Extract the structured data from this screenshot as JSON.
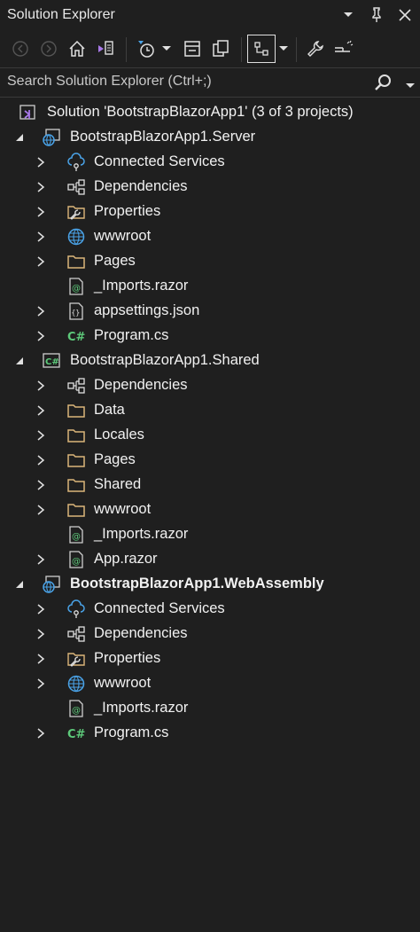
{
  "window": {
    "title": "Solution Explorer"
  },
  "search": {
    "placeholder": "Search Solution Explorer (Ctrl+;)"
  },
  "colors": {
    "background": "#1f1f1f",
    "text": "#f1f1f1",
    "accent_blue": "#4aa3e8",
    "folder": "#dcb67a",
    "csharp": "#5dc97a"
  },
  "tree": {
    "solution": "Solution 'BootstrapBlazorApp1' (3 of 3 projects)",
    "server": {
      "name": "BootstrapBlazorApp1.Server",
      "items": [
        "Connected Services",
        "Dependencies",
        "Properties",
        "wwwroot",
        "Pages",
        "_Imports.razor",
        "appsettings.json",
        "Program.cs"
      ]
    },
    "shared": {
      "name": "BootstrapBlazorApp1.Shared",
      "items": [
        "Dependencies",
        "Data",
        "Locales",
        "Pages",
        "Shared",
        "wwwroot",
        "_Imports.razor",
        "App.razor"
      ]
    },
    "wasm": {
      "name": "BootstrapBlazorApp1.WebAssembly",
      "items": [
        "Connected Services",
        "Dependencies",
        "Properties",
        "wwwroot",
        "_Imports.razor",
        "Program.cs"
      ]
    }
  }
}
